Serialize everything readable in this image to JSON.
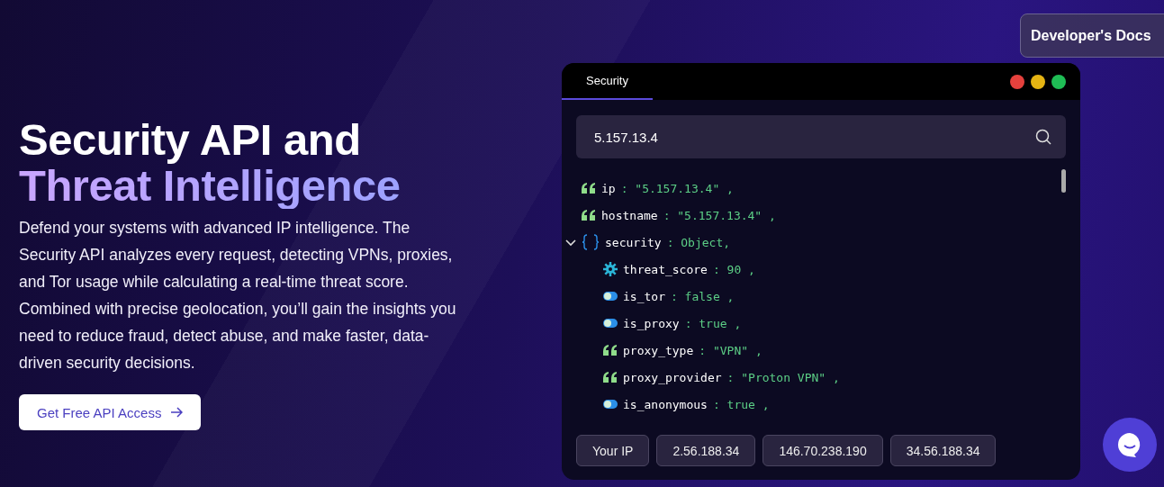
{
  "header": {
    "docs_button": "Developer's Docs"
  },
  "hero": {
    "title_line_1": "Security API and",
    "title_line_2": "Threat Intelligence",
    "description": "Defend your systems with advanced IP intelligence. The Security API analyzes every request, detecting VPNs, proxies, and Tor usage while calculating a real-time threat score. Combined with precise geolocation, you’ll gain the insights you need to reduce fraud, detect abuse, and make faster, data-driven security decisions.",
    "cta": "Get Free API Access"
  },
  "demo": {
    "tabs": [
      {
        "label": "Security",
        "selected": true
      }
    ],
    "search": {
      "value": "5.157.13.4"
    },
    "response": [
      {
        "key": "ip",
        "kind": "string",
        "value": ": \"5.157.13.4\" ,"
      },
      {
        "key": "hostname",
        "kind": "string",
        "value": ": \"5.157.13.4\" ,"
      },
      {
        "key": "security",
        "kind": "object",
        "value": ": Object,",
        "expanded": true,
        "children": [
          {
            "key": "threat_score",
            "kind": "number",
            "value": ": 90 ,"
          },
          {
            "key": "is_tor",
            "kind": "boolean",
            "value": ": false ,"
          },
          {
            "key": "is_proxy",
            "kind": "boolean",
            "value": ": true ,"
          },
          {
            "key": "proxy_type",
            "kind": "string",
            "value": ": \"VPN\" ,"
          },
          {
            "key": "proxy_provider",
            "kind": "string",
            "value": ": \"Proton VPN\" ,"
          },
          {
            "key": "is_anonymous",
            "kind": "boolean",
            "value": ": true ,"
          }
        ]
      }
    ],
    "sample_ips": [
      "Your IP",
      "2.56.188.34",
      "146.70.238.190",
      "34.56.188.34"
    ]
  }
}
